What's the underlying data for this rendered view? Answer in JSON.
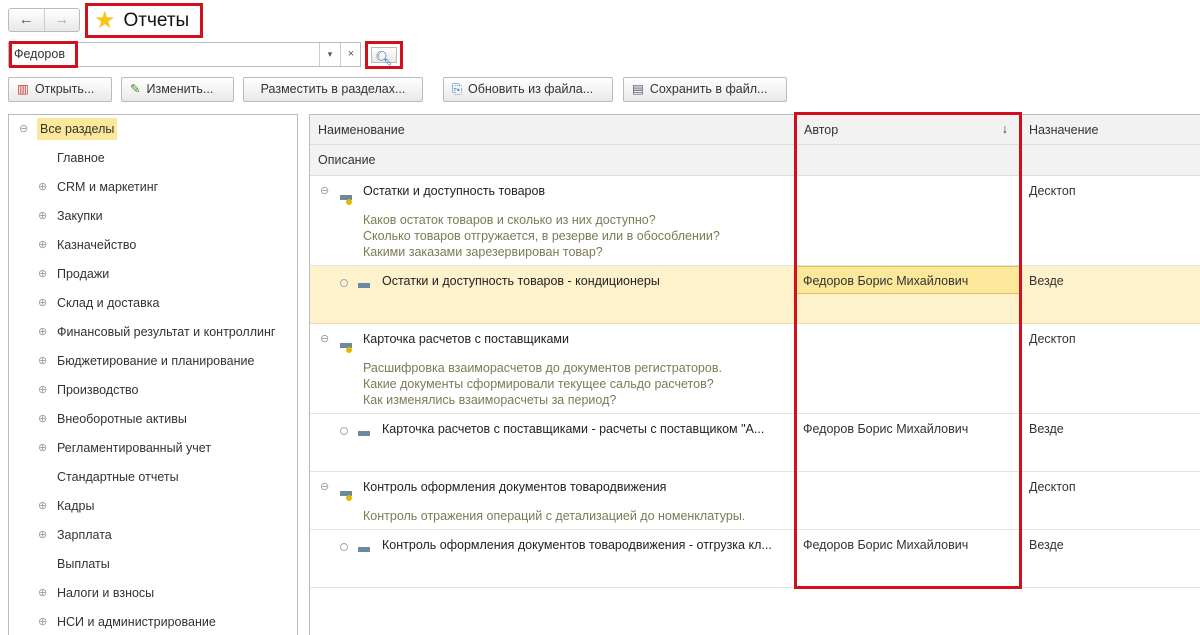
{
  "header": {
    "title": "Отчеты",
    "back": "←",
    "forward": "→"
  },
  "search": {
    "value": "Федоров",
    "dropdown": "▾",
    "clear": "×",
    "find_icon": "search-icon"
  },
  "toolbar": {
    "open": "Открыть...",
    "edit": "Изменить...",
    "place": "Разместить в разделах...",
    "update": "Обновить из файла...",
    "save": "Сохранить в файл..."
  },
  "sidebar": {
    "items": [
      {
        "label": "Все разделы",
        "expander": "⊖",
        "selected": true
      },
      {
        "label": "Главное",
        "expander": ""
      },
      {
        "label": "CRM и маркетинг",
        "expander": "⊕"
      },
      {
        "label": "Закупки",
        "expander": "⊕"
      },
      {
        "label": "Казначейство",
        "expander": "⊕"
      },
      {
        "label": "Продажи",
        "expander": "⊕"
      },
      {
        "label": "Склад и доставка",
        "expander": "⊕"
      },
      {
        "label": "Финансовый результат и контроллинг",
        "expander": "⊕"
      },
      {
        "label": "Бюджетирование и планирование",
        "expander": "⊕"
      },
      {
        "label": "Производство",
        "expander": "⊕"
      },
      {
        "label": "Внеоборотные активы",
        "expander": "⊕"
      },
      {
        "label": "Регламентированный учет",
        "expander": "⊕"
      },
      {
        "label": "Стандартные отчеты",
        "expander": ""
      },
      {
        "label": "Кадры",
        "expander": "⊕"
      },
      {
        "label": "Зарплата",
        "expander": "⊕"
      },
      {
        "label": "Выплаты",
        "expander": ""
      },
      {
        "label": "Налоги и взносы",
        "expander": "⊕"
      },
      {
        "label": "НСИ и администрирование",
        "expander": "⊕"
      }
    ]
  },
  "grid": {
    "columns": {
      "name": "Наименование",
      "author": "Автор",
      "sort": "↓",
      "purpose": "Назначение",
      "description": "Описание"
    },
    "groups": [
      {
        "name": "Остатки и доступность товаров",
        "purpose": "Десктоп",
        "expander": "⊖",
        "description": [
          "Каков остаток товаров и сколько из них доступно?",
          "Сколько товаров отгружается, в резерве или в обособлении?",
          "Какими заказами зарезервирован товар?"
        ],
        "item": {
          "name": "Остатки и доступность товаров - кондиционеры",
          "author": "Федоров Борис Михайлович",
          "purpose": "Везде"
        }
      },
      {
        "name": "Карточка расчетов с поставщиками",
        "purpose": "Десктоп",
        "expander": "⊖",
        "description": [
          "Расшифровка взаиморасчетов до документов регистраторов.",
          "Какие документы сформировали текущее сальдо расчетов?",
          "Как изменялись взаиморасчеты за период?"
        ],
        "item": {
          "name": "Карточка расчетов с поставщиками - расчеты с поставщиком \"А...",
          "author": "Федоров Борис Михайлович",
          "purpose": "Везде"
        }
      },
      {
        "name": "Контроль оформления документов товародвижения",
        "purpose": "Десктоп",
        "expander": "⊖",
        "description": [
          "Контроль отражения операций с детализацией до номенклатуры."
        ],
        "item": {
          "name": "Контроль оформления документов товародвижения - отгрузка кл...",
          "author": "Федоров Борис Михайлович",
          "purpose": "Везде"
        }
      }
    ]
  },
  "colors": {
    "highlight": "#d0101c",
    "selection": "#fbe89a"
  }
}
